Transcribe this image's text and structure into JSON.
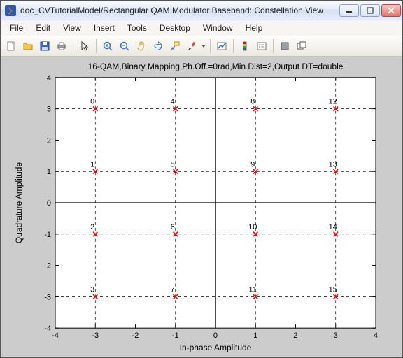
{
  "window": {
    "title": "doc_CVTutorialModel/Rectangular QAM Modulator Baseband: Constellation View"
  },
  "menu": {
    "file": "File",
    "edit": "Edit",
    "view": "View",
    "insert": "Insert",
    "tools": "Tools",
    "desktop": "Desktop",
    "window": "Window",
    "help": "Help"
  },
  "chart_data": {
    "type": "scatter",
    "title": "16-QAM,Binary Mapping,Ph.Off.=0rad,Min.Dist=2,Output DT=double",
    "xlabel": "In-phase Amplitude",
    "ylabel": "Quadrature Amplitude",
    "xlim": [
      -4,
      4
    ],
    "ylim": [
      -4,
      4
    ],
    "xticks": [
      -4,
      -3,
      -2,
      -1,
      0,
      1,
      2,
      3,
      4
    ],
    "yticks": [
      -4,
      -3,
      -2,
      -1,
      0,
      1,
      2,
      3,
      4
    ],
    "series": [
      {
        "name": "constellation",
        "x": [
          -3,
          -3,
          -3,
          -3,
          -1,
          -1,
          -1,
          -1,
          1,
          1,
          1,
          1,
          3,
          3,
          3,
          3
        ],
        "y": [
          3,
          1,
          -1,
          -3,
          3,
          1,
          -1,
          -3,
          3,
          1,
          -1,
          -3,
          3,
          1,
          -1,
          -3
        ],
        "labels": [
          "0",
          "1",
          "2",
          "3",
          "4",
          "5",
          "6",
          "7",
          "8",
          "9",
          "10",
          "11",
          "12",
          "13",
          "14",
          "15"
        ]
      }
    ],
    "marker": {
      "symbol": "x",
      "color": "#ff0000"
    },
    "grid": {
      "x": [
        -3,
        -1,
        1,
        3
      ],
      "y": [
        -3,
        -1,
        1,
        3
      ],
      "style": "dashed"
    }
  }
}
